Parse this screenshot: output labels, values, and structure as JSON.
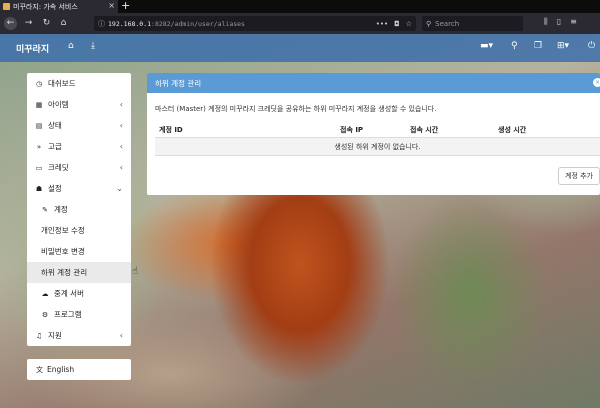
{
  "browser": {
    "tab_title": "미꾸라지: 가속 서비스",
    "url_host": "192.168.0.1",
    "url_rest": ":8282/admin/user/aliases",
    "search_placeholder": "Search"
  },
  "app": {
    "brand": "미꾸라지"
  },
  "sidebar": {
    "items": [
      {
        "label": "대쉬보드",
        "icon": "dashboard-icon"
      },
      {
        "label": "아이템",
        "icon": "items-icon",
        "chevron": "‹"
      },
      {
        "label": "상태",
        "icon": "status-icon",
        "chevron": "‹"
      },
      {
        "label": "고급",
        "icon": "advanced-icon",
        "chevron": "‹"
      },
      {
        "label": "크레딧",
        "icon": "credit-icon",
        "chevron": "‹"
      },
      {
        "label": "설정",
        "icon": "user-settings-icon",
        "chevron": "⌄"
      },
      {
        "label": "계정",
        "icon": "wrench-icon"
      },
      {
        "label": "개인정보 수정"
      },
      {
        "label": "비밀번호 변경"
      },
      {
        "label": "하위 계정 관리"
      },
      {
        "label": "중계 서버",
        "icon": "cloud-icon"
      },
      {
        "label": "프로그램",
        "icon": "gear-icon"
      },
      {
        "label": "지원",
        "icon": "headset-icon",
        "chevron": "‹"
      }
    ],
    "language": "English"
  },
  "panel": {
    "title": "하위 계정 관리",
    "description": "마스터 (Master) 계정의 미꾸라지 크레딧을 공유하는 하위 미꾸라지 계정을 생성할 수 있습니다.",
    "columns": [
      "계정 ID",
      "접속 IP",
      "접속 시간",
      "생성 시간"
    ],
    "empty_message": "생성된 하위 계정이 없습니다.",
    "add_button": "계정 추가"
  }
}
